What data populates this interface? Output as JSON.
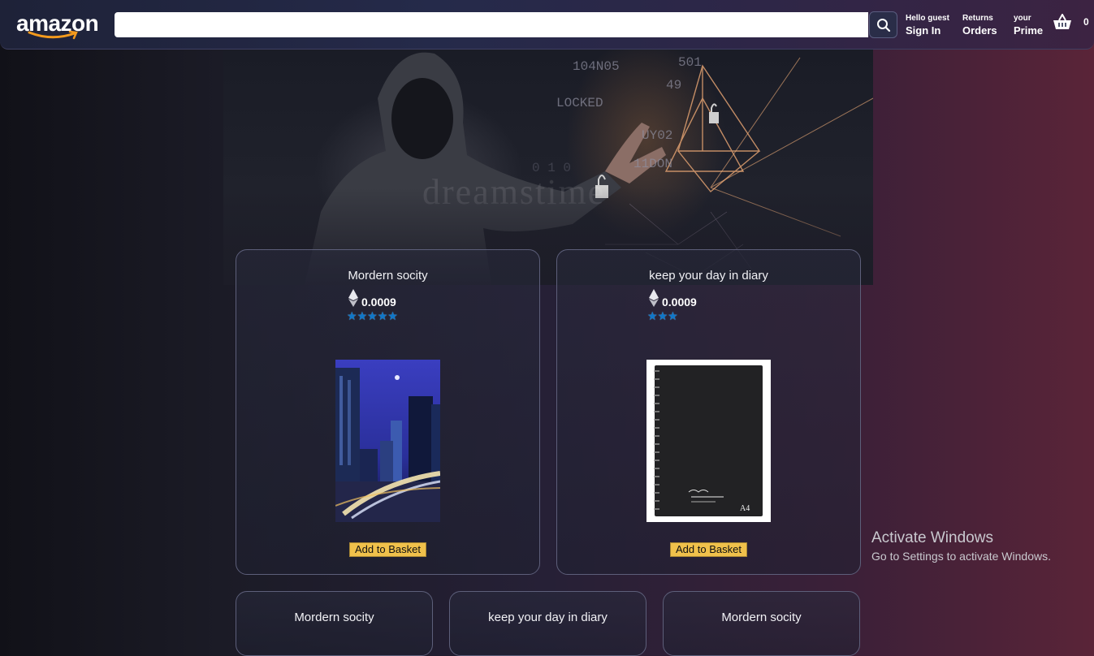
{
  "header": {
    "logo_text": "amazon",
    "search": {
      "value": "",
      "placeholder": ""
    },
    "nav": [
      {
        "line1": "Hello guest",
        "line2": "Sign In"
      },
      {
        "line1": "Returns",
        "line2": "Orders"
      },
      {
        "line1": "your",
        "line2": "Prime"
      }
    ],
    "basket_count": "0"
  },
  "hero": {
    "watermark": "dreamstime"
  },
  "products": [
    {
      "title": "Mordern socity",
      "price": "0.0009",
      "rating": 5,
      "button": "Add to Basket",
      "image": "city-night-photo"
    },
    {
      "title": "keep your day in diary",
      "price": "0.0009",
      "rating": 3,
      "button": "Add to Basket",
      "image": "black-notebook-photo"
    },
    {
      "title": "Mordern socity"
    },
    {
      "title": "keep your day in diary"
    },
    {
      "title": "Mordern socity"
    }
  ],
  "notebook_label": "A4",
  "os_overlay": {
    "title": "Activate Windows",
    "subtitle": "Go to Settings to activate Windows."
  },
  "colors": {
    "button": "#f0c14b",
    "star": "#0e77c9",
    "header": "#252a4a"
  }
}
